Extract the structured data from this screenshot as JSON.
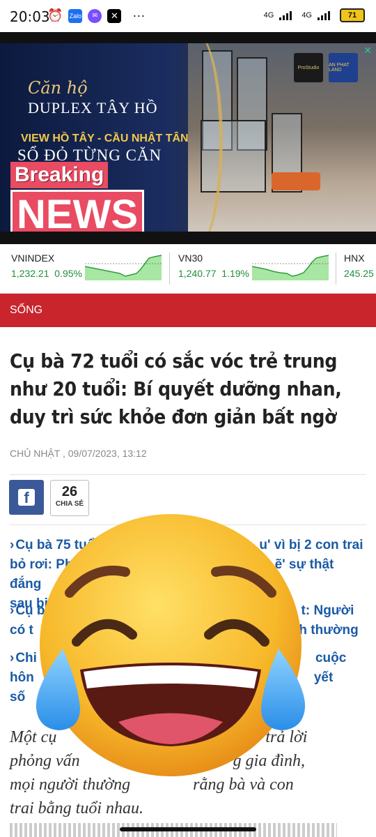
{
  "status_bar": {
    "time": "20:03",
    "network_1": "4G",
    "network_2": "4G",
    "battery": "71",
    "more": "···",
    "icons": [
      "alarm-icon",
      "zalo-icon",
      "messenger-icon",
      "x-icon"
    ]
  },
  "banner": {
    "line1": "Căn hộ",
    "line2": "DUPLEX TÂY HỒ",
    "line3": "VIEW HỒ TÂY - CẦU NHẬT TÂN",
    "line4": "SỔ ĐỎ TỪNG CĂN",
    "breaking": "Breaking",
    "news": "NEWS",
    "logo1": "ProStudio",
    "logo2": "AN PHAT LAND"
  },
  "ticker": [
    {
      "name": "VNINDEX",
      "value": "1,232.21",
      "change": "0.95%"
    },
    {
      "name": "VN30",
      "value": "1,240.77",
      "change": "1.19%"
    },
    {
      "name": "HNX",
      "value": "245.25",
      "change": ""
    }
  ],
  "section": {
    "label": "SỐNG"
  },
  "article": {
    "title": "Cụ bà 72 tuổi có sắc vóc trẻ trung như 20 tuổi: Bí quyết dưỡng nhan, duy trì sức khỏe đơn giản bất ngờ",
    "date": "CHỦ NHẬT , 09/07/2023, 13:12",
    "share_count": "26",
    "share_label": "CHIA SẺ",
    "related": [
      {
        "line1": "Cụ bà 75 tuổ",
        "line1b": "u' vì bị 2 con trai",
        "line2": "bỏ rơi: Ph",
        "line2b": "ẽ' sự thật đắng",
        "line3": "sau bi k"
      },
      {
        "line1": "Cụ b",
        "line1b": "t: Người",
        "line2": "có t",
        "line2b": "nh thường"
      },
      {
        "line1": "Chi",
        "line1b": "cuộc",
        "line2": "hôn",
        "line2b": "yết",
        "line3": "số"
      }
    ],
    "lead_1": "Một cụ",
    "lead_1b": "trả lời",
    "lead_2": "phỏng vấn",
    "lead_2b": "g gia đình,",
    "lead_3": "mọi người thường",
    "lead_3b": "rằng bà và con",
    "lead_4": "trai bằng tuổi nhau."
  },
  "colors": {
    "section_red": "#c8252d",
    "link_blue": "#1a5aa6",
    "stock_green": "#1f8f3a",
    "facebook_blue": "#3b5998"
  }
}
